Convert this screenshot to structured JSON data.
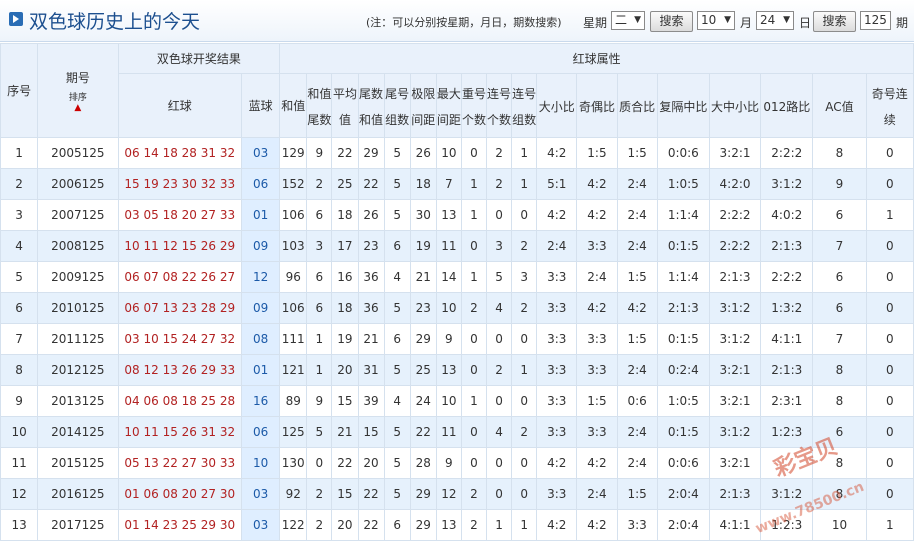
{
  "header": {
    "title": "双色球历史上的今天",
    "note": "(注：可以分别按星期，月日，期数搜索)",
    "weekday_label": "星期",
    "weekday_value": "二",
    "search1_label": "搜索",
    "month_value": "10",
    "month_label": "月",
    "day_value": "24",
    "day_label": "日",
    "search2_label": "搜索",
    "issue_value": "125",
    "period_label": "期"
  },
  "table": {
    "group_draw": "双色球开奖结果",
    "group_attr": "红球属性",
    "col_idx": "序号",
    "col_issue": "期号",
    "sort_label": "排序",
    "col_red": "红球",
    "col_blue": "蓝球",
    "attr_headers": [
      "和值",
      "和值尾数",
      "平均值",
      "尾数和值",
      "尾号组数",
      "极限间距",
      "最大间距",
      "重号个数",
      "连号个数",
      "连号组数",
      "大小比",
      "奇偶比",
      "质合比",
      "复隔中比",
      "大中小比",
      "012路比",
      "AC值",
      "奇号连续"
    ],
    "rows": [
      {
        "idx": "1",
        "issue": "2005125",
        "red": "06 14 18 28 31 32",
        "blue": "03",
        "attrs": [
          "129",
          "9",
          "22",
          "29",
          "5",
          "26",
          "10",
          "0",
          "2",
          "1",
          "4:2",
          "1:5",
          "1:5",
          "0:0:6",
          "3:2:1",
          "2:2:2",
          "8",
          "0"
        ]
      },
      {
        "idx": "2",
        "issue": "2006125",
        "red": "15 19 23 30 32 33",
        "blue": "06",
        "attrs": [
          "152",
          "2",
          "25",
          "22",
          "5",
          "18",
          "7",
          "1",
          "2",
          "1",
          "5:1",
          "4:2",
          "2:4",
          "1:0:5",
          "4:2:0",
          "3:1:2",
          "9",
          "0"
        ]
      },
      {
        "idx": "3",
        "issue": "2007125",
        "red": "03 05 18 20 27 33",
        "blue": "01",
        "attrs": [
          "106",
          "6",
          "18",
          "26",
          "5",
          "30",
          "13",
          "1",
          "0",
          "0",
          "4:2",
          "4:2",
          "2:4",
          "1:1:4",
          "2:2:2",
          "4:0:2",
          "6",
          "1"
        ]
      },
      {
        "idx": "4",
        "issue": "2008125",
        "red": "10 11 12 15 26 29",
        "blue": "09",
        "attrs": [
          "103",
          "3",
          "17",
          "23",
          "6",
          "19",
          "11",
          "0",
          "3",
          "2",
          "2:4",
          "3:3",
          "2:4",
          "0:1:5",
          "2:2:2",
          "2:1:3",
          "7",
          "0"
        ]
      },
      {
        "idx": "5",
        "issue": "2009125",
        "red": "06 07 08 22 26 27",
        "blue": "12",
        "attrs": [
          "96",
          "6",
          "16",
          "36",
          "4",
          "21",
          "14",
          "1",
          "5",
          "3",
          "3:3",
          "2:4",
          "1:5",
          "1:1:4",
          "2:1:3",
          "2:2:2",
          "6",
          "0"
        ]
      },
      {
        "idx": "6",
        "issue": "2010125",
        "red": "06 07 13 23 28 29",
        "blue": "09",
        "attrs": [
          "106",
          "6",
          "18",
          "36",
          "5",
          "23",
          "10",
          "2",
          "4",
          "2",
          "3:3",
          "4:2",
          "4:2",
          "2:1:3",
          "3:1:2",
          "1:3:2",
          "6",
          "0"
        ]
      },
      {
        "idx": "7",
        "issue": "2011125",
        "red": "03 10 15 24 27 32",
        "blue": "08",
        "attrs": [
          "111",
          "1",
          "19",
          "21",
          "6",
          "29",
          "9",
          "0",
          "0",
          "0",
          "3:3",
          "3:3",
          "1:5",
          "0:1:5",
          "3:1:2",
          "4:1:1",
          "7",
          "0"
        ]
      },
      {
        "idx": "8",
        "issue": "2012125",
        "red": "08 12 13 26 29 33",
        "blue": "01",
        "attrs": [
          "121",
          "1",
          "20",
          "31",
          "5",
          "25",
          "13",
          "0",
          "2",
          "1",
          "3:3",
          "3:3",
          "2:4",
          "0:2:4",
          "3:2:1",
          "2:1:3",
          "8",
          "0"
        ]
      },
      {
        "idx": "9",
        "issue": "2013125",
        "red": "04 06 08 18 25 28",
        "blue": "16",
        "attrs": [
          "89",
          "9",
          "15",
          "39",
          "4",
          "24",
          "10",
          "1",
          "0",
          "0",
          "3:3",
          "1:5",
          "0:6",
          "1:0:5",
          "3:2:1",
          "2:3:1",
          "8",
          "0"
        ]
      },
      {
        "idx": "10",
        "issue": "2014125",
        "red": "10 11 15 26 31 32",
        "blue": "06",
        "attrs": [
          "125",
          "5",
          "21",
          "15",
          "5",
          "22",
          "11",
          "0",
          "4",
          "2",
          "3:3",
          "3:3",
          "2:4",
          "0:1:5",
          "3:1:2",
          "1:2:3",
          "6",
          "0"
        ]
      },
      {
        "idx": "11",
        "issue": "2015125",
        "red": "05 13 22 27 30 33",
        "blue": "10",
        "attrs": [
          "130",
          "0",
          "22",
          "20",
          "5",
          "28",
          "9",
          "0",
          "0",
          "0",
          "4:2",
          "4:2",
          "2:4",
          "0:0:6",
          "3:2:1",
          "",
          "8",
          "0"
        ]
      },
      {
        "idx": "12",
        "issue": "2016125",
        "red": "01 06 08 20 27 30",
        "blue": "03",
        "attrs": [
          "92",
          "2",
          "15",
          "22",
          "5",
          "29",
          "12",
          "2",
          "0",
          "0",
          "3:3",
          "2:4",
          "1:5",
          "2:0:4",
          "2:1:3",
          "3:1:2",
          "8",
          "0"
        ]
      },
      {
        "idx": "13",
        "issue": "2017125",
        "red": "01 14 23 25 29 30",
        "blue": "03",
        "attrs": [
          "122",
          "2",
          "20",
          "22",
          "6",
          "29",
          "13",
          "2",
          "1",
          "1",
          "4:2",
          "4:2",
          "3:3",
          "2:0:4",
          "4:1:1",
          "1:2:3",
          "10",
          "1"
        ]
      }
    ]
  },
  "watermark": {
    "brand": "彩宝贝",
    "url": "www.78500.cn"
  },
  "colors": {
    "title": "#1c4f8f",
    "red_ball": "#b22222",
    "blue_ball": "#1c5aa8",
    "header_bg": "#e9f1fb",
    "alt_row": "#e6f1fc"
  }
}
